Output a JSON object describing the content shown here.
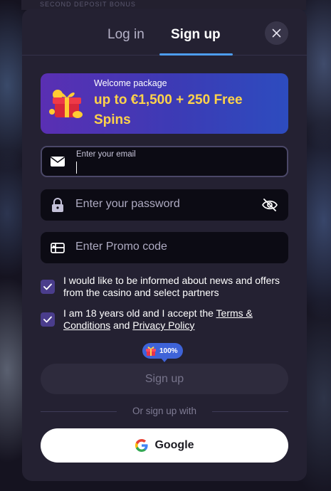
{
  "background": {
    "top_strip": "SECOND DEPOSIT BONUS"
  },
  "tabs": {
    "login": "Log in",
    "signup": "Sign up"
  },
  "banner": {
    "small": "Welcome package",
    "big": "up to €1,500 + 250 Free Spins",
    "icon": "gift-icon"
  },
  "form": {
    "email_label": "Enter your email",
    "email_value": "",
    "password_placeholder": "Enter your password",
    "promo_placeholder": "Enter Promo code"
  },
  "checkboxes": {
    "news": {
      "checked": true,
      "text": "I would like to be informed about news and offers from the casino and select partners"
    },
    "age": {
      "checked": true,
      "prefix": "I am 18 years old and I accept the ",
      "terms_link": "Terms & Conditions",
      "and": " and ",
      "privacy_link": "Privacy Policy"
    }
  },
  "completion_badge": "100%",
  "submit_label": "Sign up",
  "divider_text": "Or sign up with",
  "google_label": "Google",
  "colors": {
    "tab_underline": "#4d9df0",
    "banner_highlight": "#ffd34a",
    "checkbox": "#4a3d8c"
  }
}
